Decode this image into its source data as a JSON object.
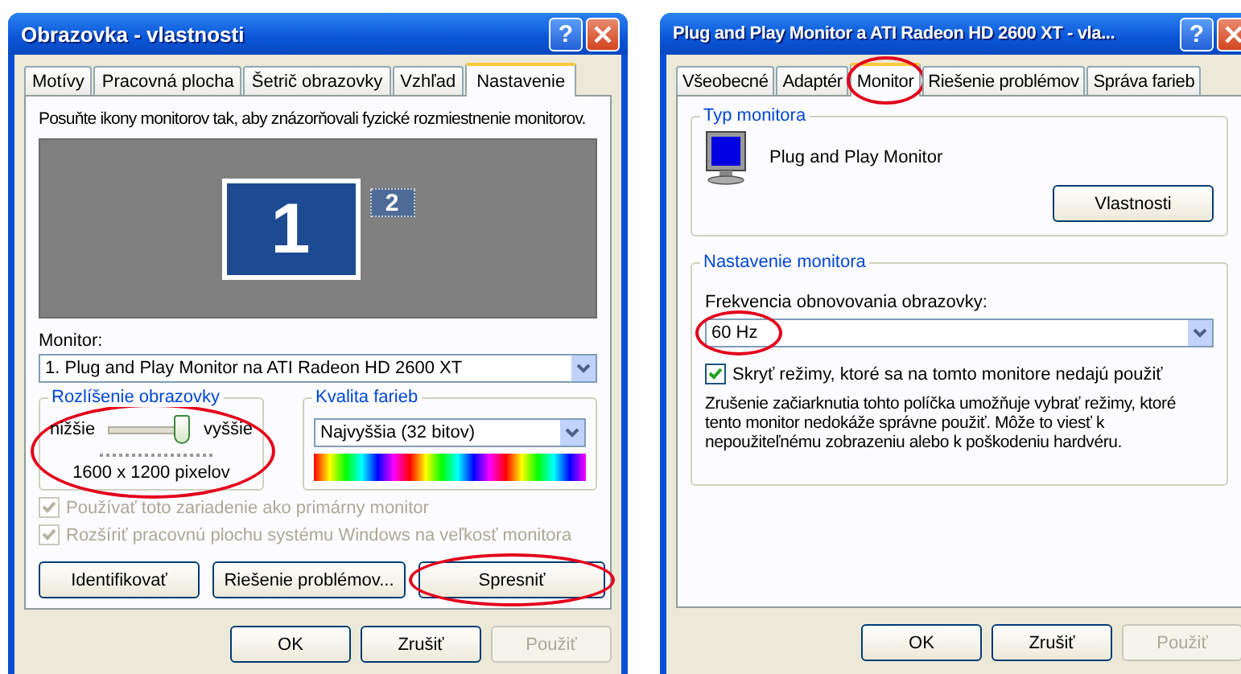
{
  "left_window": {
    "title": "Obrazovka - vlastnosti",
    "help_glyph": "?",
    "tabs": [
      {
        "label": "Motívy",
        "selected": false
      },
      {
        "label": "Pracovná plocha",
        "selected": false
      },
      {
        "label": "Šetrič obrazovky",
        "selected": false
      },
      {
        "label": "Vzhľad",
        "selected": false
      },
      {
        "label": "Nastavenie",
        "selected": true
      }
    ],
    "instruction": "Posuňte ikony monitorov tak, aby znázorňovali fyzické rozmiestnenie monitorov.",
    "monitors": [
      {
        "label": "1",
        "selected": true
      },
      {
        "label": "2",
        "selected": false
      }
    ],
    "monitor_label": "Monitor:",
    "monitor_select": {
      "value": "1. Plug and Play Monitor na ATI Radeon HD 2600 XT"
    },
    "resolution": {
      "title": "Rozlíšenie obrazovky",
      "low": "nižšie",
      "high": "vyššie",
      "level": 0.9,
      "reading": "1600 x 1200 pixelov",
      "highlighted": true
    },
    "color_quality": {
      "title": "Kvalita farieb",
      "value": "Najvyššia (32 bitov)"
    },
    "checkboxes": [
      {
        "label": "Používať toto zariadenie ako primárny monitor",
        "checked": true,
        "disabled": true
      },
      {
        "label": "Rozšíriť pracovnú plochu systému Windows na veľkosť monitora",
        "checked": true,
        "disabled": true
      }
    ],
    "actions": [
      {
        "label": "Identifikovať",
        "highlighted": false
      },
      {
        "label": "Riešenie problémov...",
        "highlighted": false
      },
      {
        "label": "Spresniť",
        "highlighted": true
      }
    ],
    "buttons": [
      {
        "label": "OK",
        "disabled": false
      },
      {
        "label": "Zrušiť",
        "disabled": false
      },
      {
        "label": "Použiť",
        "disabled": true
      }
    ]
  },
  "right_window": {
    "title": "Plug and Play Monitor a ATI Radeon HD 2600 XT - vla...",
    "help_glyph": "?",
    "tabs": [
      {
        "label": "Všeobecné",
        "selected": false,
        "highlighted": false
      },
      {
        "label": "Adaptér",
        "selected": false,
        "highlighted": false
      },
      {
        "label": "Monitor",
        "selected": true,
        "highlighted": true
      },
      {
        "label": "Riešenie problémov",
        "selected": false,
        "highlighted": false
      },
      {
        "label": "Správa farieb",
        "selected": false,
        "highlighted": false
      }
    ],
    "monitor_type": {
      "title": "Typ monitora",
      "name": "Plug and Play Monitor",
      "button": "Vlastnosti"
    },
    "monitor_settings": {
      "title": "Nastavenie monitora",
      "refresh_label": "Frekvencia obnovovania obrazovky:",
      "refresh": {
        "value": "60 Hz",
        "highlighted": true
      },
      "hide_modes": {
        "label": "Skryť režimy, ktoré sa na tomto monitore nedajú použiť",
        "checked": true,
        "disabled": false
      },
      "note": "Zrušenie začiarknutia tohto políčka umožňuje vybrať režimy, ktoré tento monitor nedokáže správne použiť. Môže to viesť k nepoužiteľnému zobrazeniu alebo k poškodeniu hardvéru."
    },
    "buttons": [
      {
        "label": "OK",
        "disabled": false
      },
      {
        "label": "Zrušiť",
        "disabled": false
      },
      {
        "label": "Použiť",
        "disabled": true
      }
    ]
  }
}
